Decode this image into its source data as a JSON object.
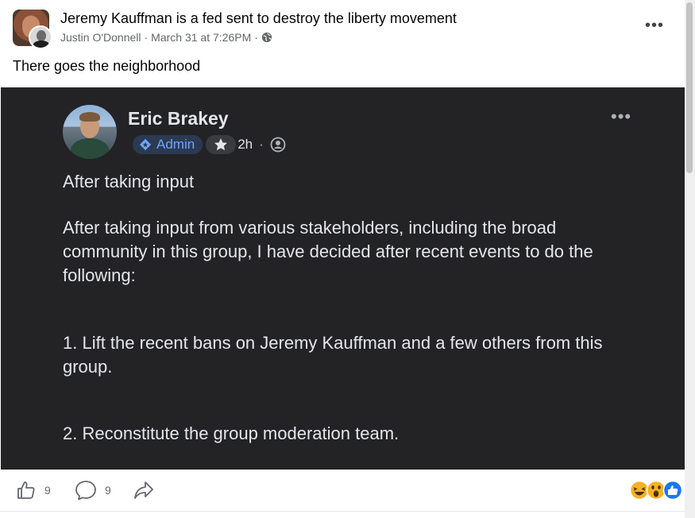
{
  "group": {
    "title": "Jeremy Kauffman is a fed sent to destroy the liberty movement",
    "avatar_icon": "group-avatar-photo"
  },
  "post": {
    "author": "Justin O'Donnell",
    "separator": "·",
    "timestamp": "March 31 at 7:26PM",
    "audience_icon": "globe-icon",
    "text": "There goes the neighborhood",
    "more_icon": "more-options-icon"
  },
  "shared_image": {
    "author": "Eric Brakey",
    "role_badge": "Admin",
    "time": "2h",
    "dot": "·",
    "paragraphs": [
      "After taking input",
      "After taking input from various stakeholders, including the broad community in this group, I have decided after recent events to do the following:",
      "1. Lift the recent bans on Jeremy Kauffman and a few others from this group.",
      "2. Reconstitute the group moderation team."
    ],
    "colors": {
      "background": "#232326",
      "text": "#e4e6eb",
      "admin_blue": "#6ea4ff"
    }
  },
  "actions": {
    "like_count": "9",
    "comment_count": "9",
    "like_icon": "thumbs-up-icon",
    "comment_icon": "comment-icon",
    "share_icon": "share-icon"
  },
  "reactions": [
    "haha-icon",
    "wow-icon",
    "like-reaction-icon"
  ]
}
